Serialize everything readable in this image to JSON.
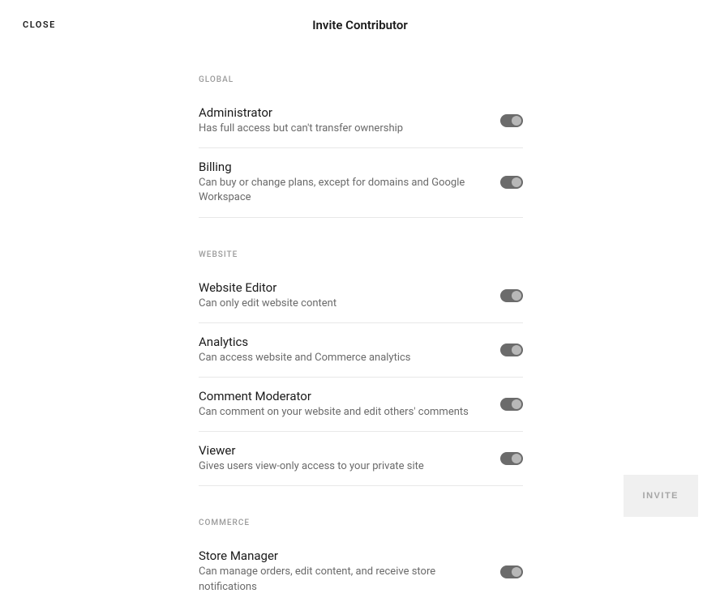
{
  "header": {
    "close": "CLOSE",
    "title": "Invite Contributor"
  },
  "sections": [
    {
      "label": "GLOBAL",
      "items": [
        {
          "title": "Administrator",
          "desc": "Has full access but can't transfer ownership"
        },
        {
          "title": "Billing",
          "desc": "Can buy or change plans, except for domains and Google Workspace"
        }
      ]
    },
    {
      "label": "WEBSITE",
      "items": [
        {
          "title": "Website Editor",
          "desc": "Can only edit website content"
        },
        {
          "title": "Analytics",
          "desc": "Can access website and Commerce analytics"
        },
        {
          "title": "Comment Moderator",
          "desc": "Can comment on your website and edit others' comments"
        },
        {
          "title": "Viewer",
          "desc": "Gives users view-only access to your private site"
        }
      ]
    },
    {
      "label": "COMMERCE",
      "items": [
        {
          "title": "Store Manager",
          "desc": "Can manage orders, edit content, and receive store notifications"
        }
      ]
    }
  ],
  "footer": {
    "invite": "INVITE"
  }
}
